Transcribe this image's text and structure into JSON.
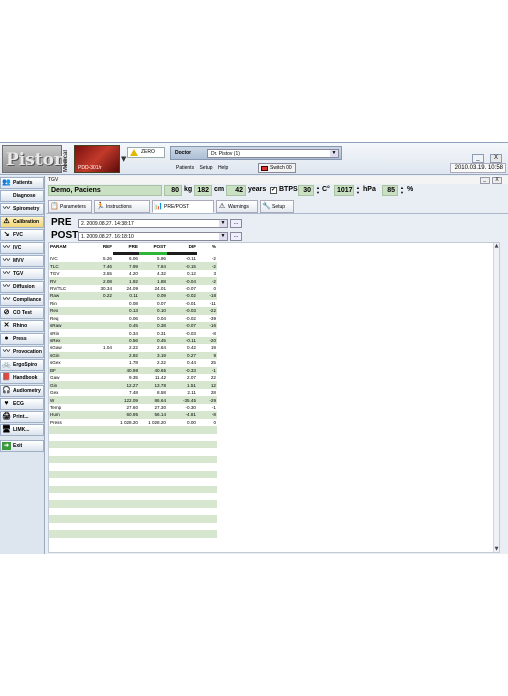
{
  "header": {
    "logo_text": "Piston",
    "logo_medical": "Medical",
    "brand_caption": "PDD-301/r",
    "zero_label": "ZERO",
    "doctor_label": "Doctor",
    "doctor_value": "Dr. Pistov (1)",
    "menu_items": [
      "Patients",
      "Setup",
      "Help"
    ],
    "switch_label": "Switch 00",
    "datetime": "2010.03.19. 10:58",
    "win_min": "_",
    "win_close": "X"
  },
  "sidebar": {
    "items": [
      {
        "label": "Patients",
        "icon": "patients-icon",
        "glyph": "👥"
      },
      {
        "label": "Diagnose",
        "icon": "diagnose-icon",
        "glyph": ""
      },
      {
        "label": "Spirometry",
        "icon": "spirometry-icon",
        "glyph": "〰"
      },
      {
        "label": "Calibration",
        "icon": "warning-icon",
        "glyph": "⚠"
      },
      {
        "label": "FVC",
        "icon": "fvc-icon",
        "glyph": "↘"
      },
      {
        "label": "IVC",
        "icon": "ivc-icon",
        "glyph": "〰"
      },
      {
        "label": "MVV",
        "icon": "mvv-icon",
        "glyph": "〰"
      },
      {
        "label": "TGV",
        "icon": "tgv-icon",
        "glyph": "〰"
      },
      {
        "label": "Diffusion",
        "icon": "diffusion-icon",
        "glyph": "〰"
      },
      {
        "label": "Compliance",
        "icon": "compliance-icon",
        "glyph": "〰"
      },
      {
        "label": "CO Test",
        "icon": "no-smoking-icon",
        "glyph": "⊘"
      },
      {
        "label": "Rhino",
        "icon": "rhino-icon",
        "glyph": "✕"
      },
      {
        "label": "Press",
        "icon": "press-icon",
        "glyph": "●"
      },
      {
        "label": "Provocation",
        "icon": "provocation-icon",
        "glyph": "〰"
      },
      {
        "label": "ErgoSpiro",
        "icon": "ergospiro-icon",
        "glyph": "🚲"
      },
      {
        "label": "Handbook",
        "icon": "handbook-icon",
        "glyph": "📕"
      },
      {
        "label": "Audiometry",
        "icon": "audiometry-icon",
        "glyph": "🎧"
      },
      {
        "label": "ECG",
        "icon": "ecg-icon",
        "glyph": "♥"
      },
      {
        "label": "Print...",
        "icon": "print-icon",
        "glyph": "🖨"
      },
      {
        "label": "LIMK...",
        "icon": "link-icon",
        "glyph": "🖥"
      },
      {
        "label": "Exit",
        "icon": "exit-icon",
        "glyph": "➜"
      }
    ]
  },
  "panel": {
    "title": "TGV",
    "patient_name": "Demo, Paciens",
    "weight": "80",
    "weight_unit": "kg",
    "height": "182",
    "height_unit": "cm",
    "age": "42",
    "age_unit": "years",
    "btps_label": "BTPS",
    "temp": "30",
    "temp_unit": "C°",
    "pressure": "1017",
    "pressure_unit": "hPa",
    "humidity": "85",
    "humidity_unit": "%"
  },
  "tabs": [
    {
      "label": "Parameters",
      "icon": "parameters-icon",
      "glyph": "📋"
    },
    {
      "label": "Instructions",
      "icon": "instructions-icon",
      "glyph": "🏃"
    },
    {
      "label": "PRE/POST",
      "icon": "prepost-icon",
      "glyph": "📊"
    },
    {
      "label": "Warnings",
      "icon": "warning-icon",
      "glyph": "⚠"
    },
    {
      "label": "Setup",
      "icon": "setup-icon",
      "glyph": "🔧"
    }
  ],
  "prepost": {
    "pre_label": "PRE",
    "pre_value": "2. 2009.08.27. 14:38:17",
    "post_label": "POST",
    "post_value": "1. 2009.08.27. 16:18:10",
    "btn_label": "..."
  },
  "table": {
    "headers": [
      "PARAM",
      "REF",
      "PRE",
      "POST",
      "DIF",
      "%"
    ],
    "bar_colors": {
      "pre": "#1c1c1c",
      "post": "#2fb63a",
      "dif": "#1c1c1c"
    },
    "rows": [
      [
        "IVC",
        "5.26",
        "6.06",
        "5.96",
        "-0.11",
        "-2"
      ],
      [
        "TLC",
        "7.46",
        "7.99",
        "7.84",
        "-0.15",
        "-2"
      ],
      [
        "TGV",
        "3.55",
        "4.20",
        "4.32",
        "0.12",
        "3"
      ],
      [
        "RV",
        "2.08",
        "1.92",
        "1.88",
        "-0.04",
        "-2"
      ],
      [
        "RV/TLC",
        "30.34",
        "24.09",
        "24.01",
        "-0.07",
        "0"
      ],
      [
        "Raw",
        "0.22",
        "0.11",
        "0.09",
        "-0.02",
        "-18"
      ],
      [
        "Rin",
        "",
        "0.08",
        "0.07",
        "-0.01",
        "-11"
      ],
      [
        "Rex",
        "",
        "0.13",
        "0.10",
        "-0.03",
        "-22"
      ],
      [
        "Req",
        "",
        "0.06",
        "0.04",
        "-0.02",
        "-39"
      ],
      [
        "sRaw",
        "",
        "0.45",
        "0.38",
        "-0.07",
        "-16"
      ],
      [
        "sRin",
        "",
        "0.34",
        "0.31",
        "-0.03",
        "-8"
      ],
      [
        "sRex",
        "",
        "0.56",
        "0.45",
        "-0.11",
        "-20"
      ],
      [
        "sGaw",
        "1.04",
        "2.22",
        "2.64",
        "0.42",
        "19"
      ],
      [
        "sGin",
        "",
        "2.92",
        "3.19",
        "0.27",
        "9"
      ],
      [
        "sGex",
        "",
        "1.78",
        "2.22",
        "0.44",
        "25"
      ],
      [
        "BF",
        "",
        "40.98",
        "40.65",
        "-0.33",
        "-1"
      ],
      [
        "Gaw",
        "",
        "9.35",
        "11.42",
        "2.07",
        "22"
      ],
      [
        "Gin",
        "",
        "12.27",
        "13.78",
        "1.51",
        "12"
      ],
      [
        "Gex",
        "",
        "7.48",
        "8.58",
        "2.11",
        "28"
      ],
      [
        "W",
        "",
        "122.09",
        "86.64",
        "-35.45",
        "-29"
      ],
      [
        "Temp",
        "",
        "27.60",
        "27.30",
        "-0.30",
        "-1"
      ],
      [
        "Hum",
        "",
        "60.95",
        "56.14",
        "-4.81",
        "-8"
      ],
      [
        "Press",
        "",
        "1 028.20",
        "1 028.20",
        "0.00",
        "0"
      ]
    ]
  }
}
